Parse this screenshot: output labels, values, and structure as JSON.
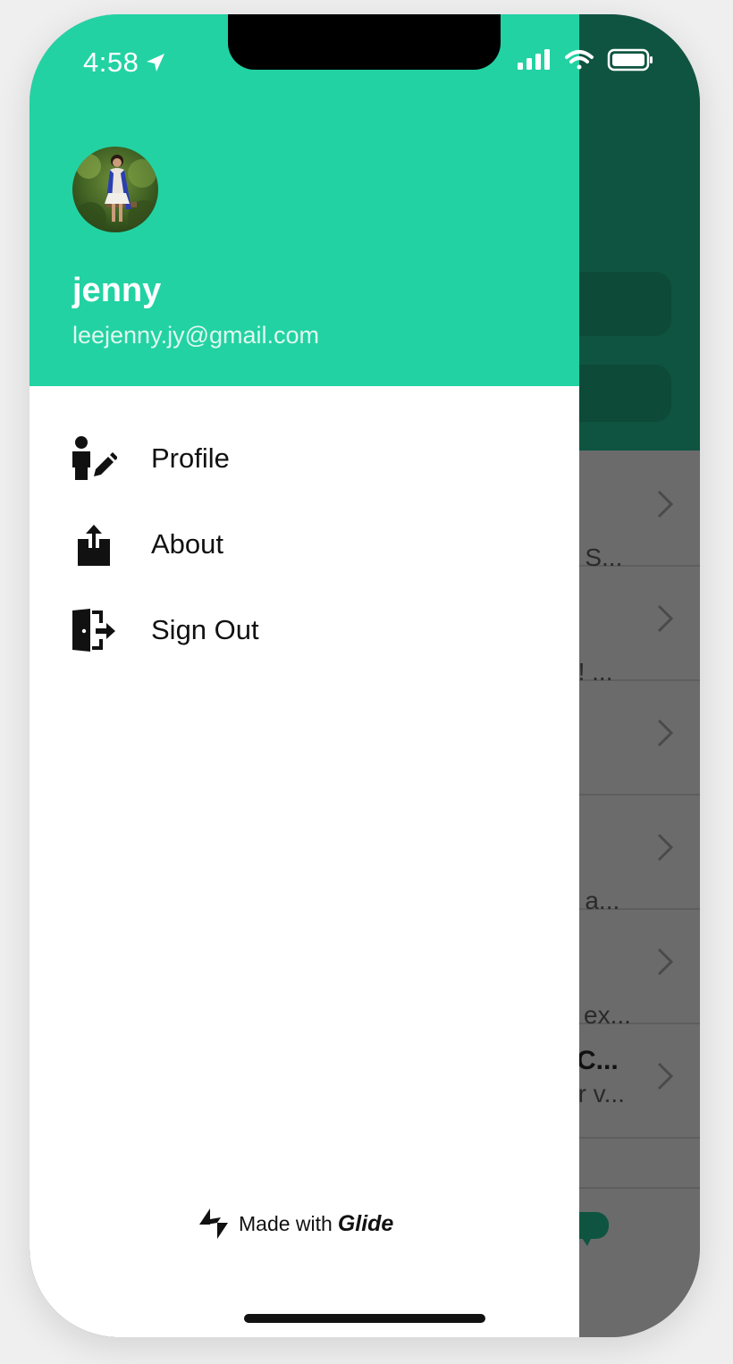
{
  "status_bar": {
    "time": "4:58"
  },
  "drawer": {
    "user": {
      "name": "jenny",
      "email": "leejenny.jy@gmail.com"
    },
    "menu": [
      {
        "label": "Profile",
        "icon": "person-edit-icon"
      },
      {
        "label": "About",
        "icon": "share-icon"
      },
      {
        "label": "Sign Out",
        "icon": "exit-door-icon"
      }
    ],
    "footer": {
      "made_with": "Made with",
      "brand": "Glide"
    }
  },
  "background_list": [
    {
      "subtitle": "n S..."
    },
    {
      "subtitle": "d! ..."
    },
    {
      "subtitle": ""
    },
    {
      "subtitle": "e a..."
    },
    {
      "subtitle": "ex..."
    },
    {
      "title": "C...",
      "subtitle": "or v..."
    }
  ],
  "colors": {
    "drawer_header": "#22d2a3",
    "app_header_dimmed": "#0f5441",
    "overlay": "#6b6b6b"
  }
}
